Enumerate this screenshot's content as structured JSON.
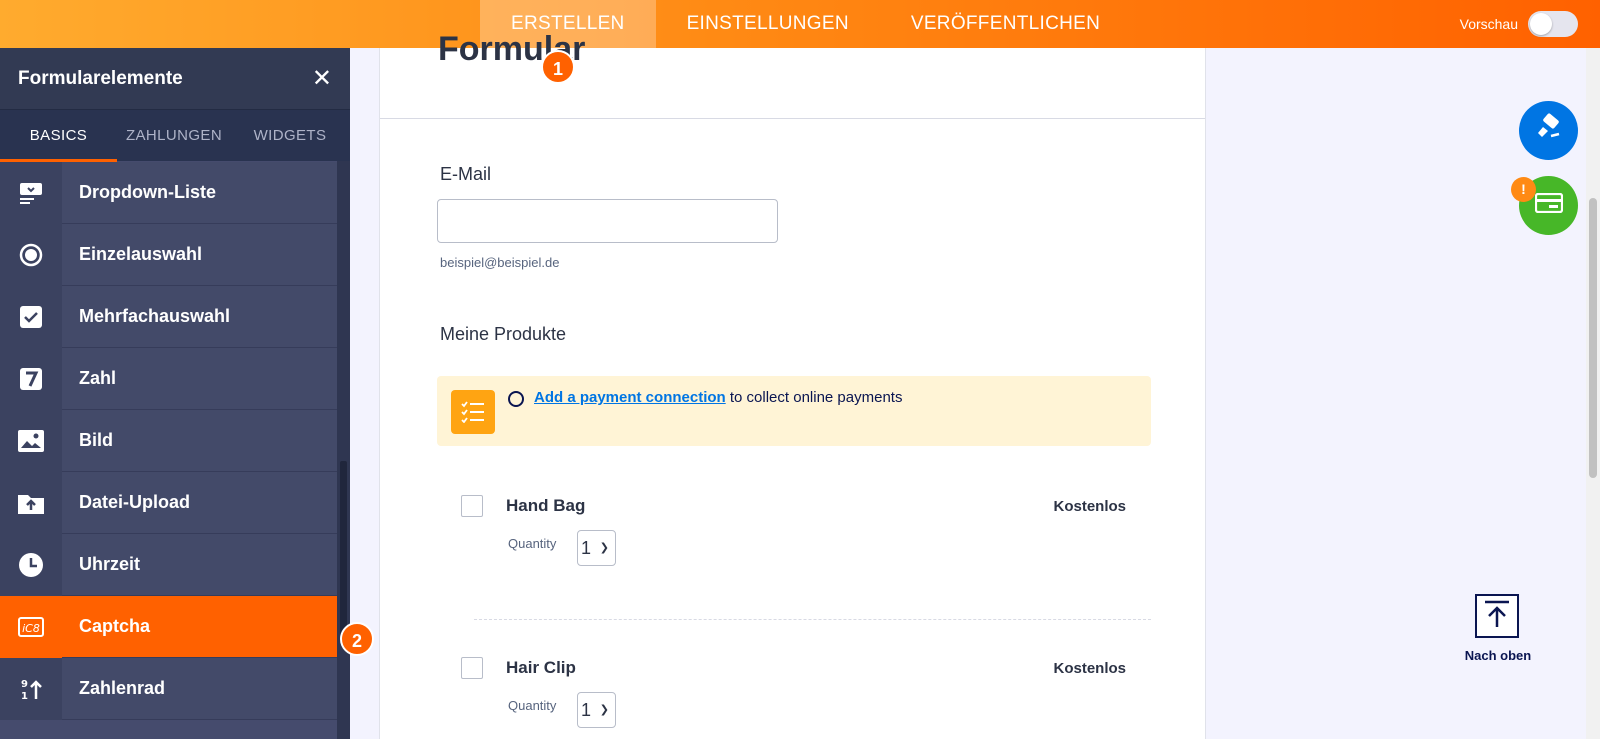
{
  "topbar": {
    "tabs": [
      {
        "label": "ERSTELLEN",
        "active": true
      },
      {
        "label": "EINSTELLUNGEN",
        "active": false
      },
      {
        "label": "VERÖFFENTLICHEN",
        "active": false
      }
    ],
    "preview_label": "Vorschau",
    "preview_on": false
  },
  "sidebar": {
    "title": "Formularelemente",
    "close_icon": "close-icon",
    "tabs": [
      {
        "label": "BASICS",
        "active": true
      },
      {
        "label": "ZAHLUNGEN",
        "active": false
      },
      {
        "label": "WIDGETS",
        "active": false
      }
    ],
    "items": [
      {
        "label": "Dropdown-Liste",
        "icon": "dropdown-icon"
      },
      {
        "label": "Einzelauswahl",
        "icon": "radio-icon"
      },
      {
        "label": "Mehrfachauswahl",
        "icon": "checkbox-icon"
      },
      {
        "label": "Zahl",
        "icon": "number-icon"
      },
      {
        "label": "Bild",
        "icon": "image-icon"
      },
      {
        "label": "Datei-Upload",
        "icon": "upload-icon"
      },
      {
        "label": "Uhrzeit",
        "icon": "clock-icon"
      },
      {
        "label": "Captcha",
        "icon": "captcha-icon",
        "active": true
      },
      {
        "label": "Zahlenrad",
        "icon": "spinner-icon"
      }
    ]
  },
  "badges": {
    "one": "1",
    "two": "2"
  },
  "form": {
    "title": "Formular",
    "email_label": "E-Mail",
    "email_value": "",
    "email_sublabel": "beispiel@beispiel.de",
    "products_label": "Meine Produkte",
    "payment_link": "Add a payment connection",
    "payment_text": " to collect online payments",
    "products": [
      {
        "name": "Hand Bag",
        "price": "Kostenlos",
        "qty_label": "Quantity",
        "qty": "1"
      },
      {
        "name": "Hair Clip",
        "price": "Kostenlos",
        "qty_label": "Quantity",
        "qty": "1"
      }
    ]
  },
  "right": {
    "warning": "!",
    "scroll_top_label": "Nach oben"
  },
  "colors": {
    "accent": "#ff6100",
    "sidebar": "#454b6d",
    "link": "#0075e3",
    "green": "#47b728"
  }
}
